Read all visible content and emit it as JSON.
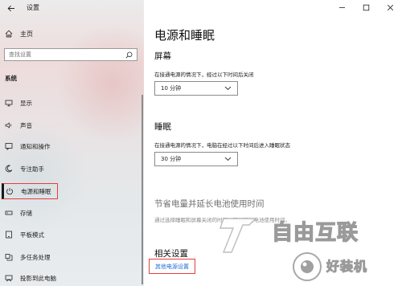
{
  "window": {
    "title": "设置",
    "controls": [
      "minimize",
      "maximize",
      "close"
    ]
  },
  "sidebar": {
    "home_label": "主页",
    "search_placeholder": "查找设置",
    "section_label": "系统",
    "items": [
      {
        "label": "显示",
        "icon": "monitor-icon"
      },
      {
        "label": "声音",
        "icon": "speaker-icon"
      },
      {
        "label": "通知和操作",
        "icon": "notification-icon"
      },
      {
        "label": "专注助手",
        "icon": "moon-icon"
      },
      {
        "label": "电源和睡眠",
        "icon": "power-icon",
        "selected": true
      },
      {
        "label": "存储",
        "icon": "storage-icon"
      },
      {
        "label": "平板模式",
        "icon": "tablet-icon"
      },
      {
        "label": "多任务处理",
        "icon": "multitask-icon"
      },
      {
        "label": "投影到此电脑",
        "icon": "projector-icon"
      }
    ]
  },
  "main": {
    "page_title": "电源和睡眠",
    "screen": {
      "heading": "屏幕",
      "description": "在接通电源的情况下，经过以下时间后关闭",
      "value": "10 分钟"
    },
    "sleep": {
      "heading": "睡眠",
      "description": "在接通电源的情况下，电脑在经过以下时间后进入睡眠状态",
      "value": "30 分钟"
    },
    "battery": {
      "heading": "节省电量并延长电池使用时间",
      "description": "通过选择睡眠和屏幕关闭的时间，可以延长电池使用时间。"
    },
    "related": {
      "heading": "相关设置",
      "link": "其他电源设置"
    }
  },
  "watermark": {
    "brand": "自由互联",
    "badge": "好装机"
  }
}
